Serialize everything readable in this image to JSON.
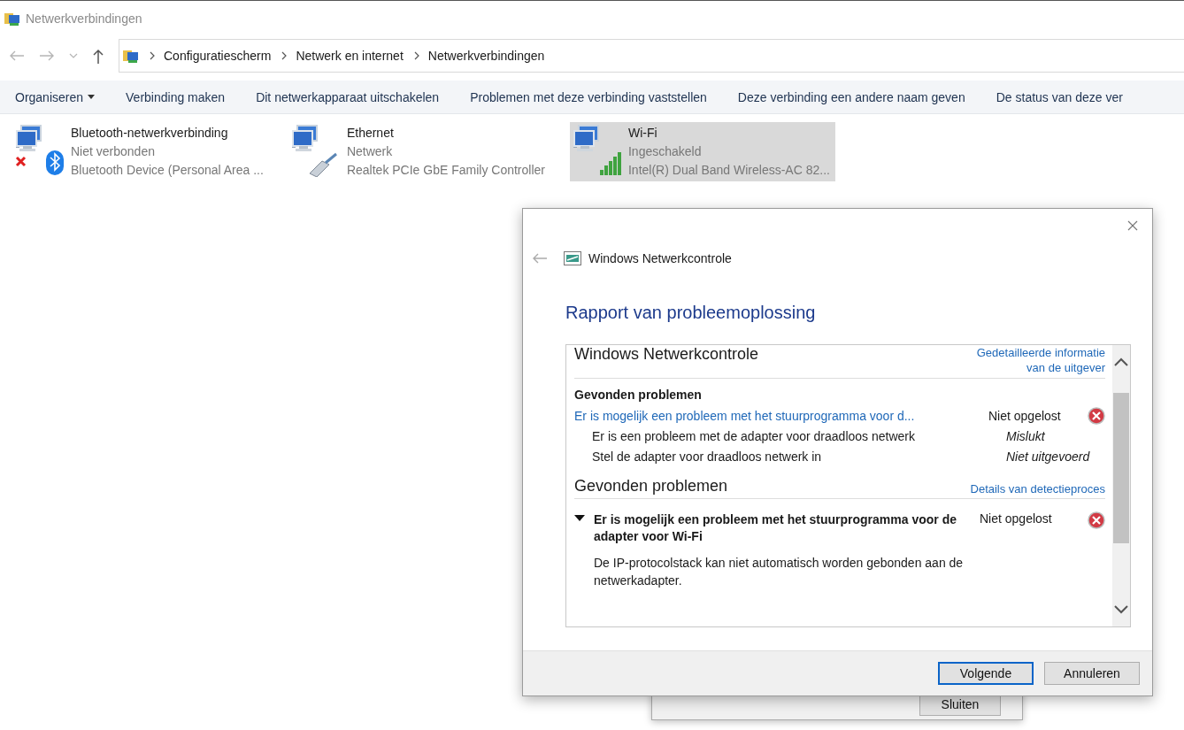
{
  "window": {
    "title": "Netwerkverbindingen"
  },
  "address": {
    "crumbs": [
      "Configuratiescherm",
      "Netwerk en internet",
      "Netwerkverbindingen"
    ]
  },
  "toolbar": [
    {
      "label": "Organiseren",
      "dropdown": true
    },
    {
      "label": "Verbinding maken",
      "dropdown": false
    },
    {
      "label": "Dit netwerkapparaat uitschakelen",
      "dropdown": false
    },
    {
      "label": "Problemen met deze verbinding vaststellen",
      "dropdown": false
    },
    {
      "label": "Deze verbinding een andere naam geven",
      "dropdown": false
    },
    {
      "label": "De status van deze ver",
      "dropdown": false
    }
  ],
  "connections": [
    {
      "kind": "bluetooth",
      "name": "Bluetooth-netwerkverbinding",
      "status": "Niet verbonden",
      "device": "Bluetooth Device (Personal Area ...",
      "selected": false
    },
    {
      "kind": "ethernet",
      "name": "Ethernet",
      "status": "Netwerk",
      "device": "Realtek PCIe GbE Family Controller",
      "selected": false
    },
    {
      "kind": "wifi",
      "name": "Wi-Fi",
      "status": "Ingeschakeld",
      "device": "Intel(R) Dual Band Wireless-AC 82...",
      "selected": true
    }
  ],
  "back_dialog": {
    "button": "Sluiten"
  },
  "dialog": {
    "app_title": "Windows Netwerkcontrole",
    "heading": "Rapport van probleemoplossing",
    "report": {
      "title": "Windows Netwerkcontrole",
      "publisher_link": "Gedetailleerde informatie van de uitgever",
      "summary_title": "Gevonden problemen",
      "summary": [
        {
          "kind": "problem",
          "text": "Er is mogelijk een probleem met het stuurprogramma voor d...",
          "status": "Niet opgelost"
        },
        {
          "kind": "step",
          "text": "Er is een probleem met de adapter voor draadloos netwerk",
          "status": "Mislukt"
        },
        {
          "kind": "step",
          "text": "Stel de adapter voor draadloos netwerk in",
          "status": "Niet uitgevoerd"
        }
      ],
      "details_title": "Gevonden problemen",
      "details_link": "Details van detectieproces",
      "detail": {
        "title": "Er is mogelijk een probleem met het stuurprogramma voor de adapter voor Wi-Fi",
        "status": "Niet opgelost",
        "expanded": true,
        "description": "De IP-protocolstack kan niet automatisch worden gebonden aan de netwerkadapter."
      }
    },
    "buttons": [
      {
        "label": "Volgende",
        "default": true
      },
      {
        "label": "Annuleren",
        "default": false
      }
    ]
  }
}
